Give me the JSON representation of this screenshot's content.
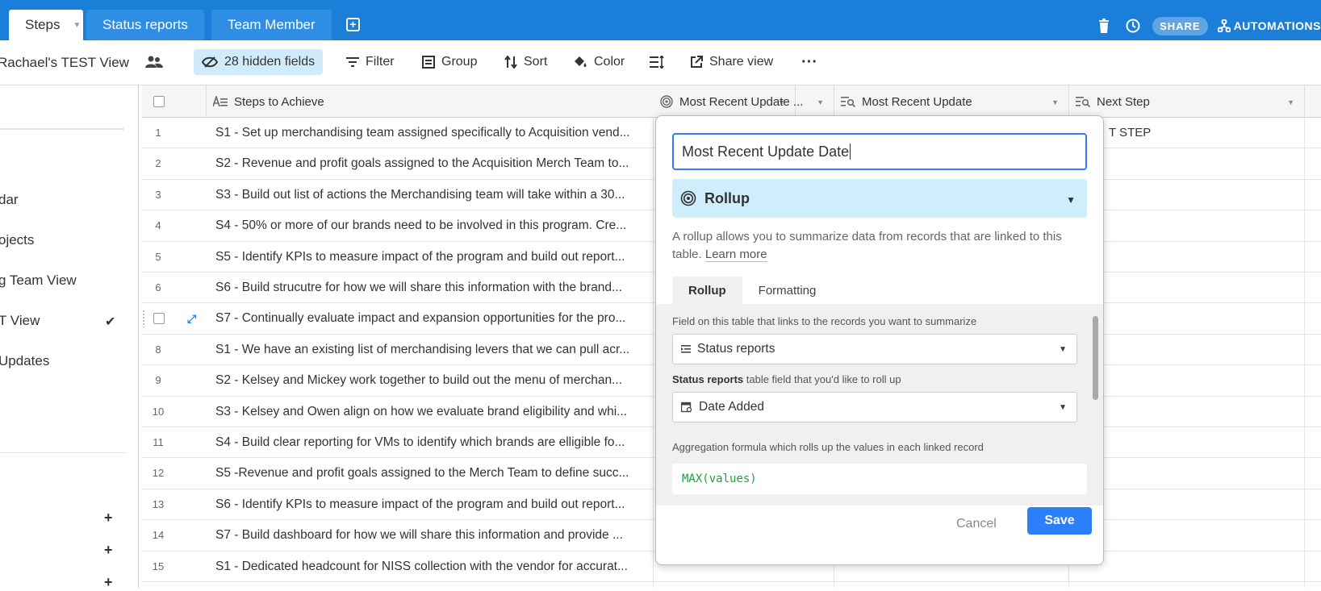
{
  "tabs": [
    {
      "label": "Steps"
    },
    {
      "label": "Status reports"
    },
    {
      "label": "Team Member"
    }
  ],
  "topbar": {
    "share": "SHARE",
    "automations": "AUTOMATIONS"
  },
  "toolbar": {
    "view_name": "Rachael's TEST View",
    "hidden_fields": "28 hidden fields",
    "filter": "Filter",
    "group": "Group",
    "sort": "Sort",
    "color": "Color",
    "share_view": "Share view"
  },
  "sidebar": {
    "items": [
      "dar",
      "ojects",
      "g Team View",
      "T View",
      "Updates"
    ],
    "active_index": 3
  },
  "columns": [
    {
      "label": "Steps to Achieve"
    },
    {
      "label": "Most Recent Update ..."
    },
    {
      "label": "Most Recent Update"
    },
    {
      "label": "Next Step"
    }
  ],
  "rows": [
    {
      "num": "1",
      "text": "S1 - Set up merchandising team assigned specifically to Acquisition vend..."
    },
    {
      "num": "2",
      "text": "S2 - Revenue and profit goals assigned to the Acquisition Merch Team to..."
    },
    {
      "num": "3",
      "text": "S3 - Build out list of actions the Merchandising team will take within a 30..."
    },
    {
      "num": "4",
      "text": "S4 - 50% or more of our brands need to be involved in this program. Cre..."
    },
    {
      "num": "5",
      "text": "S5 - Identify KPIs to measure impact of the program and build out report..."
    },
    {
      "num": "6",
      "text": "S6 - Build strucutre for how we will share this information with the brand..."
    },
    {
      "num": "",
      "text": "S7 - Continually evaluate impact and expansion opportunities for the pro..."
    },
    {
      "num": "8",
      "text": "S1 - We have an existing list of merchandising levers that we can pull acr..."
    },
    {
      "num": "9",
      "text": "S2 - Kelsey and Mickey work together to build out the menu of merchan..."
    },
    {
      "num": "10",
      "text": "S3 - Kelsey and Owen align on how we evaluate brand eligibility and whi..."
    },
    {
      "num": "11",
      "text": "S4 - Build clear reporting for VMs to identify which brands are elligible fo..."
    },
    {
      "num": "12",
      "text": "S5 -Revenue and profit goals assigned to the Merch Team to define succ..."
    },
    {
      "num": "13",
      "text": "S6 - Identify KPIs to measure impact of the program and build out report..."
    },
    {
      "num": "14",
      "text": "S7 - Build dashboard for how we will share this information and provide ..."
    },
    {
      "num": "15",
      "text": "S1 - Dedicated headcount for NISS collection with the vendor for accurat..."
    }
  ],
  "next_step_partial": "T STEP",
  "popup": {
    "field_name": "Most Recent Update Date",
    "field_type": "Rollup",
    "description": "A rollup allows you to summarize data from records that are linked to this table.",
    "learn_more": "Learn more",
    "tabs": [
      "Rollup",
      "Formatting"
    ],
    "link_label": "Field on this table that links to the records you want to summarize",
    "link_value": "Status reports",
    "rollup_label_bold": "Status reports",
    "rollup_label_rest": " table field that you'd like to roll up",
    "rollup_value": "Date Added",
    "aggregation_label": "Aggregation formula which rolls up the values in each linked record",
    "formula": "MAX(values)",
    "cancel": "Cancel",
    "save": "Save"
  },
  "colors": {
    "accent": "#2d7ff9",
    "topbar": "#1b7fd9",
    "rollup_bg": "#cfeefb",
    "formula": "#20a040"
  }
}
